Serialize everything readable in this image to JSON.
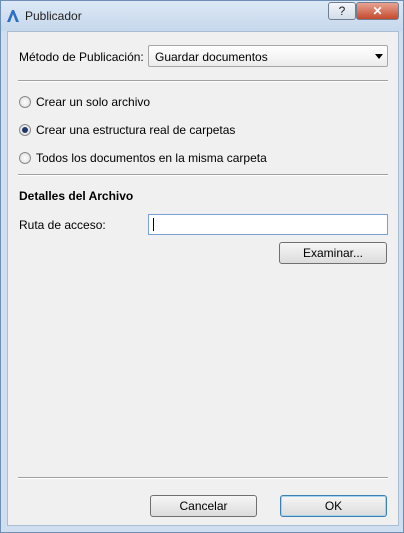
{
  "window": {
    "title": "Publicador",
    "help_label": "?",
    "close_label": "✕"
  },
  "method": {
    "label": "Método de Publicación:",
    "selected": "Guardar documentos"
  },
  "options": [
    {
      "label": "Crear un solo archivo",
      "checked": false
    },
    {
      "label": "Crear una estructura real de carpetas",
      "checked": true
    },
    {
      "label": "Todos los documentos en la misma carpeta",
      "checked": false
    }
  ],
  "details": {
    "heading": "Detalles del Archivo",
    "path_label": "Ruta de acceso:",
    "path_value": "",
    "browse_label": "Examinar..."
  },
  "footer": {
    "cancel_label": "Cancelar",
    "ok_label": "OK"
  }
}
